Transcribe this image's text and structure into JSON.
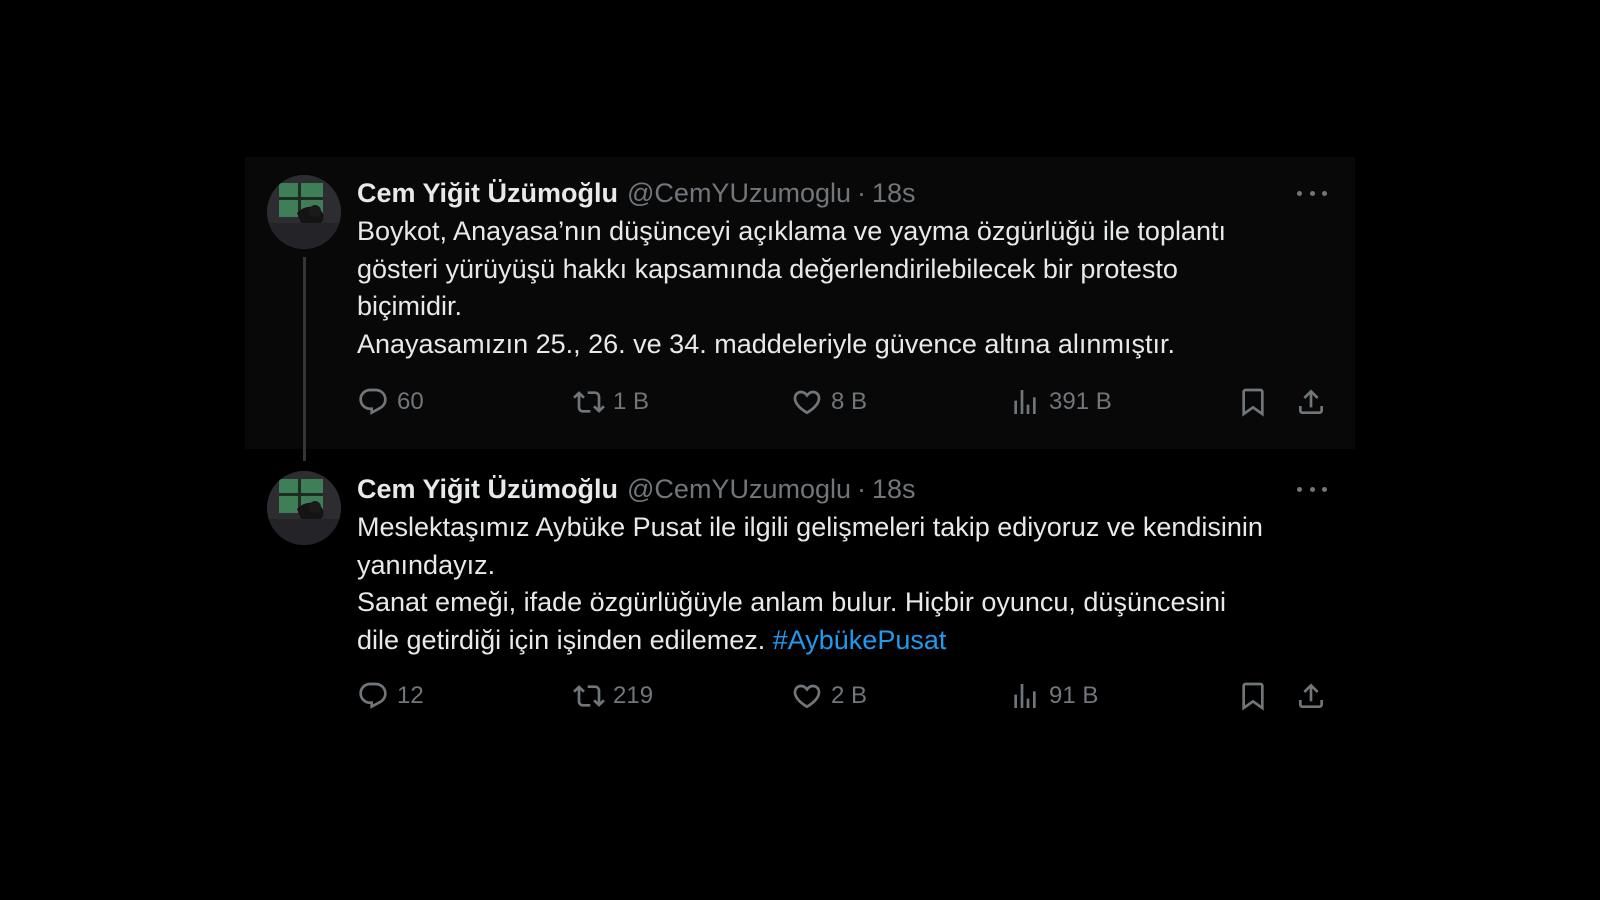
{
  "thread": {
    "tweets": [
      {
        "display_name": "Cem Yiğit Üzümoğlu",
        "handle": "@CemYUzumoglu",
        "separator": "·",
        "time": "18s",
        "text_lines": [
          "Boykot, Anayasa’nın düşünceyi açıklama ve yayma özgürlüğü ile toplantı",
          "gösteri yürüyüşü hakkı kapsamında değerlendirilebilecek bir protesto",
          "biçimidir.",
          "Anayasamızın 25., 26. ve 34. maddeleriyle güvence altına alınmıştır."
        ],
        "stats": {
          "replies": "60",
          "reposts": "1 B",
          "likes": "8 B",
          "views": "391 B"
        }
      },
      {
        "display_name": "Cem Yiğit Üzümoğlu",
        "handle": "@CemYUzumoglu",
        "separator": "·",
        "time": "18s",
        "text_lines": [
          "Meslektaşımız Aybüke Pusat ile ilgili gelişmeleri takip ediyoruz ve kendisinin",
          "yanındayız.",
          "Sanat emeği, ifade özgürlüğüyle anlam bulur. Hiçbir oyuncu, düşüncesini",
          "dile getirdiği için işinden edilemez."
        ],
        "hashtag": "#AybükePusat",
        "stats": {
          "replies": "12",
          "reposts": "219",
          "likes": "2 B",
          "views": "91 B"
        }
      }
    ]
  },
  "colors": {
    "background": "#000000",
    "highlighted_tweet_bg": "#080808",
    "primary_text": "#e7e9ea",
    "secondary_text": "#71767b",
    "link": "#1d9bf0",
    "thread_line": "#333639"
  },
  "icons": {
    "reply": "speech-bubble-icon",
    "repost": "repost-arrows-icon",
    "like": "heart-icon",
    "views": "bar-chart-icon",
    "bookmark": "bookmark-icon",
    "share": "share-upload-icon",
    "more": "three-dots-icon"
  }
}
